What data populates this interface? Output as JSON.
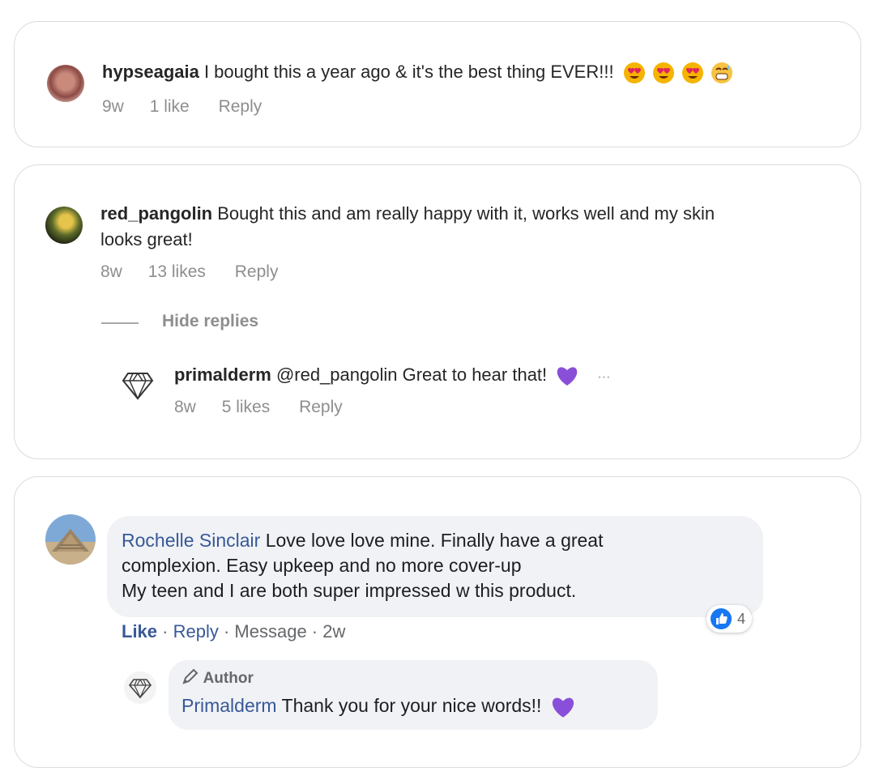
{
  "comments": [
    {
      "username": "hypseagaia",
      "text": " I bought this a year ago & it's the best thing EVER!!!",
      "emojis": [
        "heart-eyes",
        "heart-eyes",
        "heart-eyes",
        "grinning-sweat"
      ],
      "time": "9w",
      "likes": "1 like",
      "reply": "Reply"
    },
    {
      "username": "red_pangolin",
      "text_line1": " Bought this and am really happy with it, works well and my skin",
      "text_line2": "looks great!",
      "time": "8w",
      "likes": "13 likes",
      "reply": "Reply",
      "hide_replies": "Hide replies",
      "reply_item": {
        "username": "primalderm",
        "text": " @red_pangolin Great to hear that!",
        "emoji": "purple-heart",
        "more": "···",
        "time": "8w",
        "likes": "5 likes",
        "reply": "Reply"
      }
    }
  ],
  "facebook_comment": {
    "name": "Rochelle Sinclair",
    "line1": " Love love love mine. Finally have a great",
    "line2": "complexion. Easy upkeep and no more cover-up",
    "line3": "My teen and I are both super impressed w this product.",
    "like": "Like",
    "reply": "Reply",
    "message": "Message",
    "time": "2w",
    "separator": " · ",
    "reaction_count": "4",
    "author_reply": {
      "badge": "Author",
      "name": "Primalderm",
      "text": " Thank you for your nice words!!",
      "emoji": "purple-heart"
    }
  },
  "colors": {
    "fb_link": "#385898",
    "ig_meta": "#8e8e8e",
    "purple_heart": "#8a4fd8",
    "like_blue": "#1877f2"
  }
}
